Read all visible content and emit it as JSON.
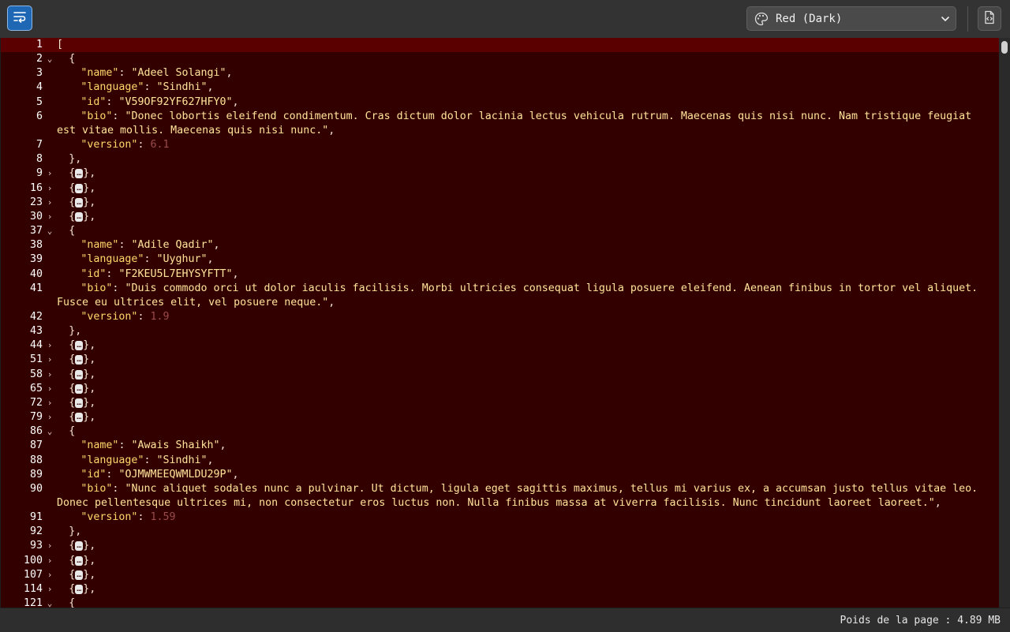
{
  "toolbar": {
    "wrap_button_icon": "wrap-lines-icon",
    "theme_select": {
      "value": "Red (Dark)",
      "icon": "palette-icon"
    },
    "raw_button_icon": "file-code-icon"
  },
  "editor": {
    "placeholder": "…",
    "lines": [
      {
        "num": "1",
        "fold": "",
        "active": true,
        "indent": 0,
        "kind": "text",
        "text": "["
      },
      {
        "num": "2",
        "fold": "⌄",
        "indent": 1,
        "kind": "text",
        "text": "{"
      },
      {
        "num": "3",
        "indent": 2,
        "kind": "kv",
        "key": "\"name\"",
        "value": "\"Adeel Solangi\"",
        "vtype": "s",
        "trail": ","
      },
      {
        "num": "4",
        "indent": 2,
        "kind": "kv",
        "key": "\"language\"",
        "value": "\"Sindhi\"",
        "vtype": "s",
        "trail": ","
      },
      {
        "num": "5",
        "indent": 2,
        "kind": "kv",
        "key": "\"id\"",
        "value": "\"V59OF92YF627HFY0\"",
        "vtype": "s",
        "trail": ","
      },
      {
        "num": "6",
        "indent": 2,
        "kind": "kv",
        "key": "\"bio\"",
        "value": "\"Donec lobortis eleifend condimentum. Cras dictum dolor lacinia lectus vehicula rutrum. Maecenas quis nisi nunc. Nam tristique feugiat est vitae mollis. Maecenas quis nisi nunc.\"",
        "vtype": "s",
        "trail": ","
      },
      {
        "num": "7",
        "indent": 2,
        "kind": "kv",
        "key": "\"version\"",
        "value": "6.1",
        "vtype": "n",
        "trail": ""
      },
      {
        "num": "8",
        "indent": 1,
        "kind": "text",
        "text": "},"
      },
      {
        "num": "9",
        "fold": "›",
        "indent": 1,
        "kind": "collapsed"
      },
      {
        "num": "16",
        "fold": "›",
        "indent": 1,
        "kind": "collapsed"
      },
      {
        "num": "23",
        "fold": "›",
        "indent": 1,
        "kind": "collapsed"
      },
      {
        "num": "30",
        "fold": "›",
        "indent": 1,
        "kind": "collapsed"
      },
      {
        "num": "37",
        "fold": "⌄",
        "indent": 1,
        "kind": "text",
        "text": "{"
      },
      {
        "num": "38",
        "indent": 2,
        "kind": "kv",
        "key": "\"name\"",
        "value": "\"Adile Qadir\"",
        "vtype": "s",
        "trail": ","
      },
      {
        "num": "39",
        "indent": 2,
        "kind": "kv",
        "key": "\"language\"",
        "value": "\"Uyghur\"",
        "vtype": "s",
        "trail": ","
      },
      {
        "num": "40",
        "indent": 2,
        "kind": "kv",
        "key": "\"id\"",
        "value": "\"F2KEU5L7EHYSYFTT\"",
        "vtype": "s",
        "trail": ","
      },
      {
        "num": "41",
        "indent": 2,
        "kind": "kv",
        "key": "\"bio\"",
        "value": "\"Duis commodo orci ut dolor iaculis facilisis. Morbi ultricies consequat ligula posuere eleifend. Aenean finibus in tortor vel aliquet. Fusce eu ultrices elit, vel posuere neque.\"",
        "vtype": "s",
        "trail": ","
      },
      {
        "num": "42",
        "indent": 2,
        "kind": "kv",
        "key": "\"version\"",
        "value": "1.9",
        "vtype": "n",
        "trail": ""
      },
      {
        "num": "43",
        "indent": 1,
        "kind": "text",
        "text": "},"
      },
      {
        "num": "44",
        "fold": "›",
        "indent": 1,
        "kind": "collapsed"
      },
      {
        "num": "51",
        "fold": "›",
        "indent": 1,
        "kind": "collapsed"
      },
      {
        "num": "58",
        "fold": "›",
        "indent": 1,
        "kind": "collapsed"
      },
      {
        "num": "65",
        "fold": "›",
        "indent": 1,
        "kind": "collapsed"
      },
      {
        "num": "72",
        "fold": "›",
        "indent": 1,
        "kind": "collapsed"
      },
      {
        "num": "79",
        "fold": "›",
        "indent": 1,
        "kind": "collapsed"
      },
      {
        "num": "86",
        "fold": "⌄",
        "indent": 1,
        "kind": "text",
        "text": "{"
      },
      {
        "num": "87",
        "indent": 2,
        "kind": "kv",
        "key": "\"name\"",
        "value": "\"Awais Shaikh\"",
        "vtype": "s",
        "trail": ","
      },
      {
        "num": "88",
        "indent": 2,
        "kind": "kv",
        "key": "\"language\"",
        "value": "\"Sindhi\"",
        "vtype": "s",
        "trail": ","
      },
      {
        "num": "89",
        "indent": 2,
        "kind": "kv",
        "key": "\"id\"",
        "value": "\"OJMWMEEQWMLDU29P\"",
        "vtype": "s",
        "trail": ","
      },
      {
        "num": "90",
        "indent": 2,
        "kind": "kv",
        "key": "\"bio\"",
        "value": "\"Nunc aliquet sodales nunc a pulvinar. Ut dictum, ligula eget sagittis maximus, tellus mi varius ex, a accumsan justo tellus vitae leo. Donec pellentesque ultrices mi, non consectetur eros luctus non. Nulla finibus massa at viverra facilisis. Nunc tincidunt laoreet laoreet.\"",
        "vtype": "s",
        "trail": ","
      },
      {
        "num": "91",
        "indent": 2,
        "kind": "kv",
        "key": "\"version\"",
        "value": "1.59",
        "vtype": "n",
        "trail": ""
      },
      {
        "num": "92",
        "indent": 1,
        "kind": "text",
        "text": "},"
      },
      {
        "num": "93",
        "fold": "›",
        "indent": 1,
        "kind": "collapsed"
      },
      {
        "num": "100",
        "fold": "›",
        "indent": 1,
        "kind": "collapsed"
      },
      {
        "num": "107",
        "fold": "›",
        "indent": 1,
        "kind": "collapsed"
      },
      {
        "num": "114",
        "fold": "›",
        "indent": 1,
        "kind": "collapsed"
      },
      {
        "num": "121",
        "fold": "⌄",
        "indent": 1,
        "kind": "text",
        "text": "{"
      }
    ]
  },
  "status": {
    "page_size": "Poids de la page : 4.89 MB"
  },
  "colors": {
    "editor_bg": "#330000",
    "active_line": "#5a0000",
    "accent": "#1d67b5"
  }
}
